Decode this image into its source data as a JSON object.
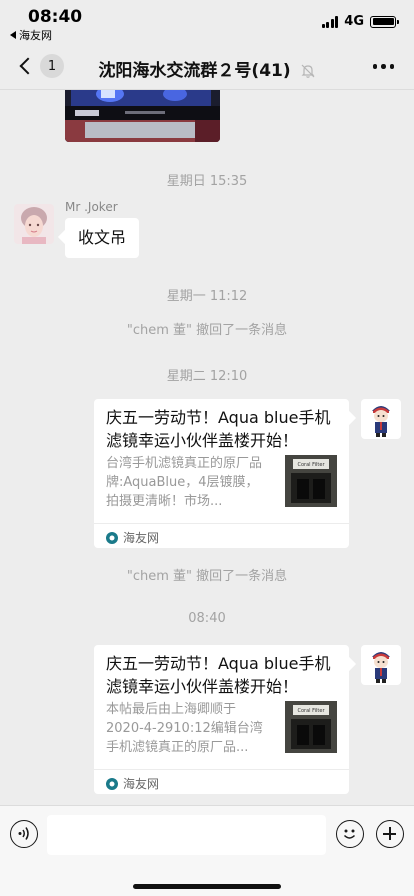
{
  "status": {
    "time": "08:40",
    "back_app": "海友网",
    "network": "4G"
  },
  "nav": {
    "unread_count": "1",
    "title": "沈阳海水交流群２号(41)"
  },
  "chat": {
    "time_sunday": "星期日 15:35",
    "message1": {
      "sender": "Mr .Joker",
      "text": "收文吊"
    },
    "time_monday": "星期一 11:12",
    "recall1": "\"chem 董\" 撤回了一条消息",
    "time_tuesday": "星期二 12:10",
    "card1": {
      "title": "庆五一劳动节！Aqua blue手机滤镜幸运小伙伴盖楼开始！",
      "desc": "台湾手机滤镜真正的原厂品牌:AquaBlue，4层镀膜，拍摄更清晰！市场...",
      "source": "海友网",
      "thumb_label": "Coral Filter"
    },
    "recall2": "\"chem 董\" 撤回了一条消息",
    "time_now": "08:40",
    "card2": {
      "title": "庆五一劳动节！Aqua blue手机滤镜幸运小伙伴盖楼开始！",
      "desc": "本帖最后由上海卿顺于2020-4-2910:12编辑台湾手机滤镜真正的原厂品...",
      "source": "海友网",
      "thumb_label": "Coral Filter"
    }
  },
  "input": {
    "placeholder": ""
  },
  "colors": {
    "background": "#ededed",
    "bubble": "#ffffff",
    "muted_text": "#a3a3a3",
    "source_icon": "#1a7a8a"
  }
}
